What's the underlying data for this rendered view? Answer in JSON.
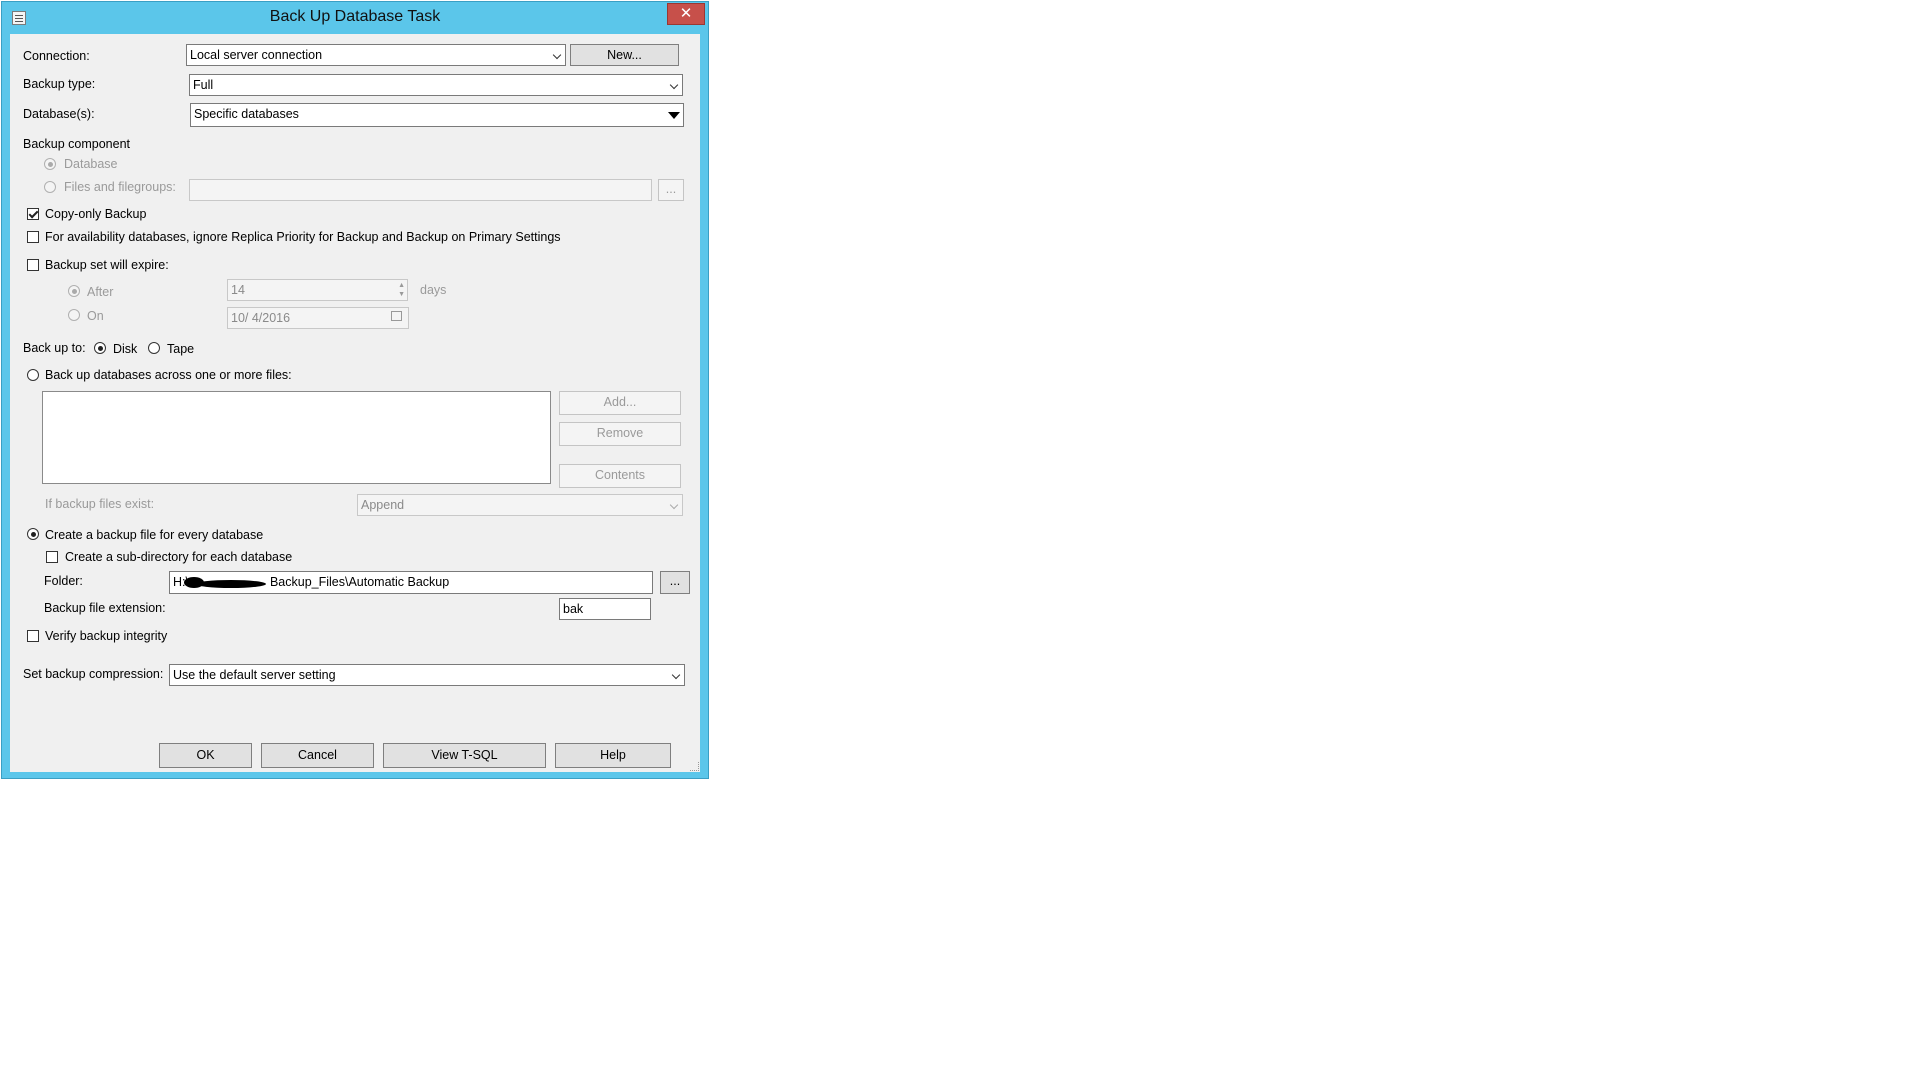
{
  "window": {
    "title": "Back Up Database Task",
    "close_glyph": "✕"
  },
  "connection": {
    "label": "Connection:",
    "value": "Local server connection",
    "new_button": "New..."
  },
  "backup_type": {
    "label": "Backup type:",
    "value": "Full"
  },
  "databases": {
    "label": "Database(s):",
    "value": "Specific databases"
  },
  "backup_component": {
    "label": "Backup component",
    "database_option": "Database",
    "files_option": "Files and filegroups:",
    "files_value": "",
    "browse_button": "..."
  },
  "copy_only": {
    "label": "Copy-only Backup",
    "checked": true
  },
  "availability": {
    "label": "For availability databases, ignore Replica Priority for Backup and Backup on Primary Settings",
    "checked": false
  },
  "expire": {
    "label": "Backup set will expire:",
    "after_label": "After",
    "after_value": "14",
    "days_label": "days",
    "on_label": "On",
    "on_value": "10/  4/2016"
  },
  "backup_to": {
    "label": "Back up to:",
    "disk": "Disk",
    "tape": "Tape"
  },
  "across_files": {
    "label": "Back up databases across one or more files:",
    "add_button": "Add...",
    "remove_button": "Remove",
    "contents_button": "Contents",
    "if_exists_label": "If backup files exist:",
    "if_exists_value": "Append"
  },
  "per_database": {
    "label": "Create a backup file for every database",
    "subdir_label": "Create a sub-directory for each database",
    "folder_label": "Folder:",
    "folder_prefix": "H:\\",
    "folder_suffix": "Backup_Files\\Automatic Backup",
    "folder_browse": "...",
    "extension_label": "Backup file extension:",
    "extension_value": "bak"
  },
  "verify": {
    "label": "Verify backup integrity"
  },
  "compression": {
    "label": "Set backup compression:",
    "value": "Use the default server setting"
  },
  "footer": {
    "ok": "OK",
    "cancel": "Cancel",
    "view_tsql": "View T-SQL",
    "help": "Help"
  },
  "colors": {
    "window_border": "#5bc6ea",
    "close": "#c7504a",
    "client": "#f0f0f0"
  }
}
